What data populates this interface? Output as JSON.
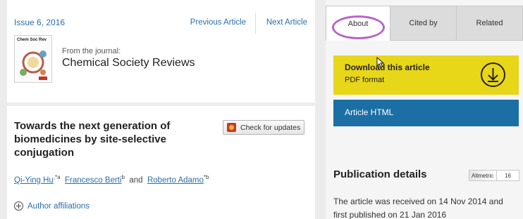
{
  "left": {
    "issue": "Issue 6, 2016",
    "prev_label": "Previous Article",
    "next_label": "Next Article",
    "cover_title": "Chem Soc Rev",
    "from_label": "From the journal:",
    "journal_name": "Chemical Society Reviews",
    "article_title": "Towards the next generation of biomedicines by site-selective conjugation",
    "check_updates": "Check for updates",
    "authors": [
      {
        "name": "Qi-Ying Hu",
        "sup": ",*a"
      },
      {
        "name": "Francesco Berti",
        "sup": "b"
      },
      {
        "name": "Roberto Adamo",
        "sup": "*b"
      }
    ],
    "authors_and": "and",
    "affiliations_label": "Author affiliations"
  },
  "right": {
    "tabs": {
      "about": "About",
      "cited": "Cited by",
      "related": "Related"
    },
    "download_title": "Download this article",
    "download_sub": "PDF format",
    "html_label": "Article HTML",
    "pub_title": "Publication details",
    "altmetric_label": "Altmetric",
    "altmetric_score": "16",
    "pub_text": "The article was received on 14 Nov 2014 and first published on 21 Jan 2016"
  },
  "colors": {
    "accent_blue": "#2a6fa8",
    "download_yellow": "#e8d619",
    "html_blue": "#1c6fa4",
    "highlight_ring": "#b864c9"
  },
  "icons": [
    "plus-circle-icon",
    "download-arrow-icon",
    "crossmark-icon",
    "mouse-cursor-icon"
  ]
}
